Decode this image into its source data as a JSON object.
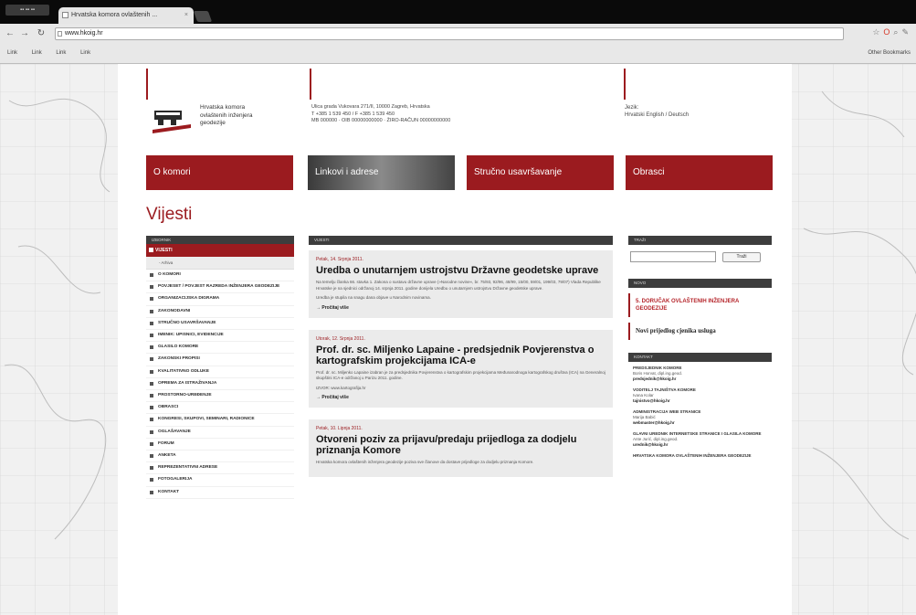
{
  "browser": {
    "window_label": "▪▪ ▪▪ ▪▪",
    "tab_title": "Hrvatska komora ovlaštenih ...",
    "tab_close": "×",
    "address": "www.hkoig.hr",
    "bookmarks": [
      "Link",
      "Link",
      "Link",
      "Link"
    ],
    "other_bookmarks": "Other Bookmarks"
  },
  "site": {
    "org_name": [
      "Hrvatska komora",
      "ovlaštenih inženjera",
      "geodezije"
    ],
    "address_lines": [
      "Ulica grada Vukovara 271/II, 10000 Zagreb, Hrvatska",
      "T +385 1 539 450 / F +385 1 539 450",
      "MB 000000 · OIB 00000000000 · ŽIRO-RAČUN 00000000000"
    ],
    "lang_label": "Jezik:",
    "lang_links": "Hrvatski English / Deutsch",
    "banners": [
      {
        "label": "O komori",
        "bg": "#9b1b1f"
      },
      {
        "label": "Linkovi i adrese",
        "bg": "#555555"
      },
      {
        "label": "Stručno usavršavanje",
        "bg": "#9b1b1f"
      },
      {
        "label": "Obrasci",
        "bg": "#9b1b1f"
      }
    ],
    "page_title": "Vijesti",
    "left_nav": {
      "header": "IZBORNIK",
      "active": "VIJESTI",
      "sub": "- Arhiva",
      "items": [
        "O KOMORI",
        "POVJESET / POVJEST RAZREDA INŽENJERA GEODEZIJE",
        "ORGANIZACIJSKA DIGRAMA",
        "ZAKONODAVNI",
        "STRUČNO USAVRŠAVANJE",
        "IMENIK: UPISNICI, EVIDENCIJE",
        "GLASILO KOMORE",
        "ZAKONSKI PROPISI",
        "KVALITATIVNO ODLUKE",
        "OPREMA ZA ISTRAŽIVANJA",
        "PROSTORNO-UREĐENJE",
        "OBRASCI",
        "KONGRESI, SKUPOVI, SEMINARI, RADIONICE",
        "OGLAŠAVANJE",
        "FORUM",
        "ANKETA",
        "REPREZENTATIVNI ADRESE",
        "FOTOGALERIJA",
        "KONTAKT"
      ]
    },
    "news": {
      "header": "VIJESTI",
      "articles": [
        {
          "date": "Petak, 14. Srpnja 2011.",
          "title": "Uredba o unutarnjem ustrojstvu Državne geodetske uprave",
          "body": "Na temelju članka 66. stavka 1. Zakona o sustavu državne uprave (»Narodne novine«, br. 75/93, 92/96, 48/99, 15/00, 59/01, 199/03, 79/07) Vlada Republike Hrvatske je na sjednici održanoj 14. srpnja 2011. godine donijela Uredbu o unutarnjem ustrojstvu Državne geodetske uprave.",
          "extra": "Uredba je stupila na snagu dana objave u Narodnim novinama.",
          "more": "→ Pročitaj više"
        },
        {
          "date": "Utorak, 12. Srpnja 2011.",
          "title": "Prof. dr. sc. Miljenko Lapaine - predsjednik Povjerenstva o kartografskim projekcijama ICA-e",
          "body": "Prof. dr. sc. Miljenko Lapaine izabran je za predsjednika Povjerenstva o kartografskim projekcijama Međunarodnoga kartografskog društva (ICA) na Generalnoj skupštini ICA-e održanoj u Parizu 2011. godine.",
          "extra": "IZVOR: www.kartografija.hr",
          "more": "→ Pročitaj više"
        },
        {
          "date": "Petak, 10. Lipnja 2011.",
          "title": "Otvoreni poziv za prijavu/predaju prijedloga za dodjelu priznanja Komore",
          "body": "Hrvatska komora ovlaštenih inženjera geodezije poziva sve članove da dostave prijedloge za dodjelu priznanja Komore.",
          "extra": "",
          "more": ""
        }
      ]
    },
    "right_col": {
      "search_header": "TRAŽI",
      "search_button": "Traži",
      "news_header": "NOVO",
      "news_items": [
        "5. DORUČAK OVLAŠTENIH INŽENJERA GEODEZIJE",
        "Novi prijedlog cjenika usluga"
      ],
      "contacts_header": "KONTAKT",
      "contacts": [
        {
          "head": "PREDSJEDNIK KOMORE",
          "name": "Boris Horvat, dipl.ing.geod.",
          "mail": "predsjednik@hkoig.hr"
        },
        {
          "head": "VODITELJ TAJNIŠTVA KOMORE",
          "name": "Ivana Kolar",
          "mail": "tajnistvo@hkoig.hr"
        },
        {
          "head": "ADMINISTRACIJA WEB STRANICE",
          "name": "Marija Babić",
          "mail": "webmaster@hkoig.hr"
        },
        {
          "head": "GLAVNI UREDNIK INTERNETSKE STRANICE I GLASILA KOMORE",
          "name": "Ante Jurić, dipl.ing.geod.",
          "mail": "urednik@hkoig.hr"
        },
        {
          "head": "HRVATSKA KOMORA OVLAŠTENIH INŽENJERA GEODEZIJE",
          "name": "",
          "mail": ""
        }
      ]
    }
  },
  "colors": {
    "brand_red": "#9b1b1f",
    "dark": "#3d3d3d",
    "article_bg": "#ebebeb"
  }
}
